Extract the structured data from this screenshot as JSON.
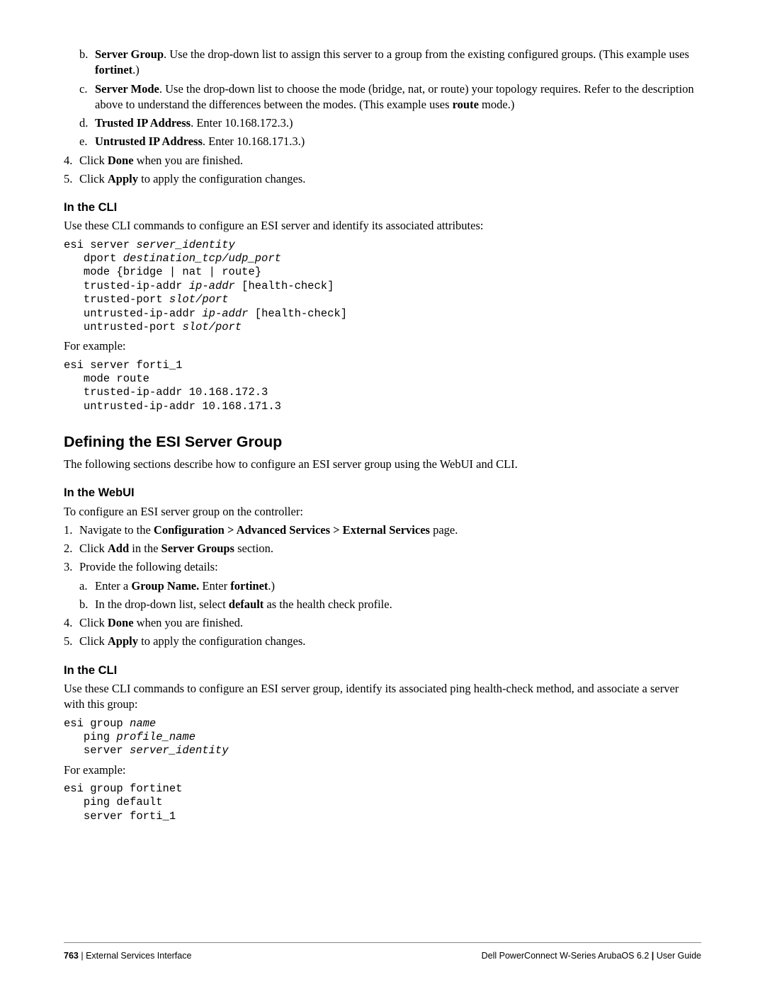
{
  "sublist_top": [
    {
      "letter": "b.",
      "prefix": "Server Group",
      "tail": ". Use the drop-down list to assign this server to a group from the existing configured groups. (This example uses ",
      "bold2": "fortinet",
      "tail2": ".)"
    },
    {
      "letter": "c.",
      "prefix": "Server Mode",
      "tail": ". Use the drop-down list to choose the mode (bridge, nat, or route) your topology requires. Refer to the description above to understand the differences between the modes. (This example uses ",
      "bold2": "route",
      "tail2": " mode.)"
    },
    {
      "letter": "d.",
      "prefix": "Trusted IP Address",
      "tail": ". Enter 10.168.172.3.)",
      "bold2": "",
      "tail2": ""
    },
    {
      "letter": "e.",
      "prefix": "Untrusted IP Address",
      "tail": ". Enter 10.168.171.3.)",
      "bold2": "",
      "tail2": ""
    }
  ],
  "ol_top": [
    {
      "num": "4.",
      "pre": "Click ",
      "bold": "Done",
      "post": " when you are finished."
    },
    {
      "num": "5.",
      "pre": "Click ",
      "bold": "Apply",
      "post": " to apply the configuration changes."
    }
  ],
  "h_cli1": "In the CLI",
  "p_cli1": "Use these CLI commands to configure an ESI server and identify its associated attributes:",
  "code1_l1a": "esi server ",
  "code1_l1b": "server_identity",
  "code1_l2a": "   dport ",
  "code1_l2b": "destination_tcp/udp_port",
  "code1_l3": "   mode {bridge | nat | route}",
  "code1_l4a": "   trusted-ip-addr ",
  "code1_l4b": "ip-addr",
  "code1_l4c": " [health-check]",
  "code1_l5a": "   trusted-port ",
  "code1_l5b": "slot/port",
  "code1_l6a": "   untrusted-ip-addr ",
  "code1_l6b": "ip-addr",
  "code1_l6c": " [health-check]",
  "code1_l7a": "   untrusted-port ",
  "code1_l7b": "slot/port",
  "p_eg1": "For example:",
  "code2": "esi server forti_1\n   mode route\n   trusted-ip-addr 10.168.172.3\n   untrusted-ip-addr 10.168.171.3",
  "h_def": "Defining the ESI Server Group",
  "p_def": "The following sections describe how to configure an ESI server group using the WebUI and CLI.",
  "h_web": "In the WebUI",
  "p_web": "To configure an ESI server group on the controller:",
  "ol_web": [
    {
      "num": "1.",
      "text_pre": "Navigate to the ",
      "bold": "Configuration > Advanced Services > External Services",
      "text_post": " page."
    },
    {
      "num": "2.",
      "text_pre": "Click ",
      "bold": "Add",
      "text_mid": " in the ",
      "bold2": "Server Groups",
      "text_post": " section."
    },
    {
      "num": "3.",
      "text_pre": "Provide the following details:",
      "bold": "",
      "text_post": ""
    }
  ],
  "sub_web": [
    {
      "letter": "a.",
      "pre": "Enter a ",
      "b1": "Group Name.",
      "mid": " Enter ",
      "b2": "fortinet",
      "post": ".)"
    },
    {
      "letter": "b.",
      "pre": "In the drop-down list, select ",
      "b1": "default",
      "mid": " as the health check profile.",
      "b2": "",
      "post": ""
    }
  ],
  "ol_web2": [
    {
      "num": "4.",
      "pre": "Click ",
      "bold": "Done",
      "post": " when you are finished."
    },
    {
      "num": "5.",
      "pre": "Click ",
      "bold": "Apply",
      "post": " to apply the configuration changes."
    }
  ],
  "h_cli2": "In the CLI",
  "p_cli2": "Use these CLI commands to configure an ESI server group, identify its associated ping health-check method, and associate a server with this group:",
  "code3_l1a": "esi group ",
  "code3_l1b": "name",
  "code3_l2a": "   ping ",
  "code3_l2b": "profile_name",
  "code3_l3a": "   server ",
  "code3_l3b": "server_identity",
  "p_eg2": "For example:",
  "code4": "esi group fortinet\n   ping default\n   server forti_1",
  "footer_page": "763",
  "footer_sep": " | ",
  "footer_left": "External Services Interface",
  "footer_right_prod": "Dell PowerConnect W-Series ArubaOS 6.2",
  "footer_right_sep": "  |  ",
  "footer_right_guide": "User Guide"
}
